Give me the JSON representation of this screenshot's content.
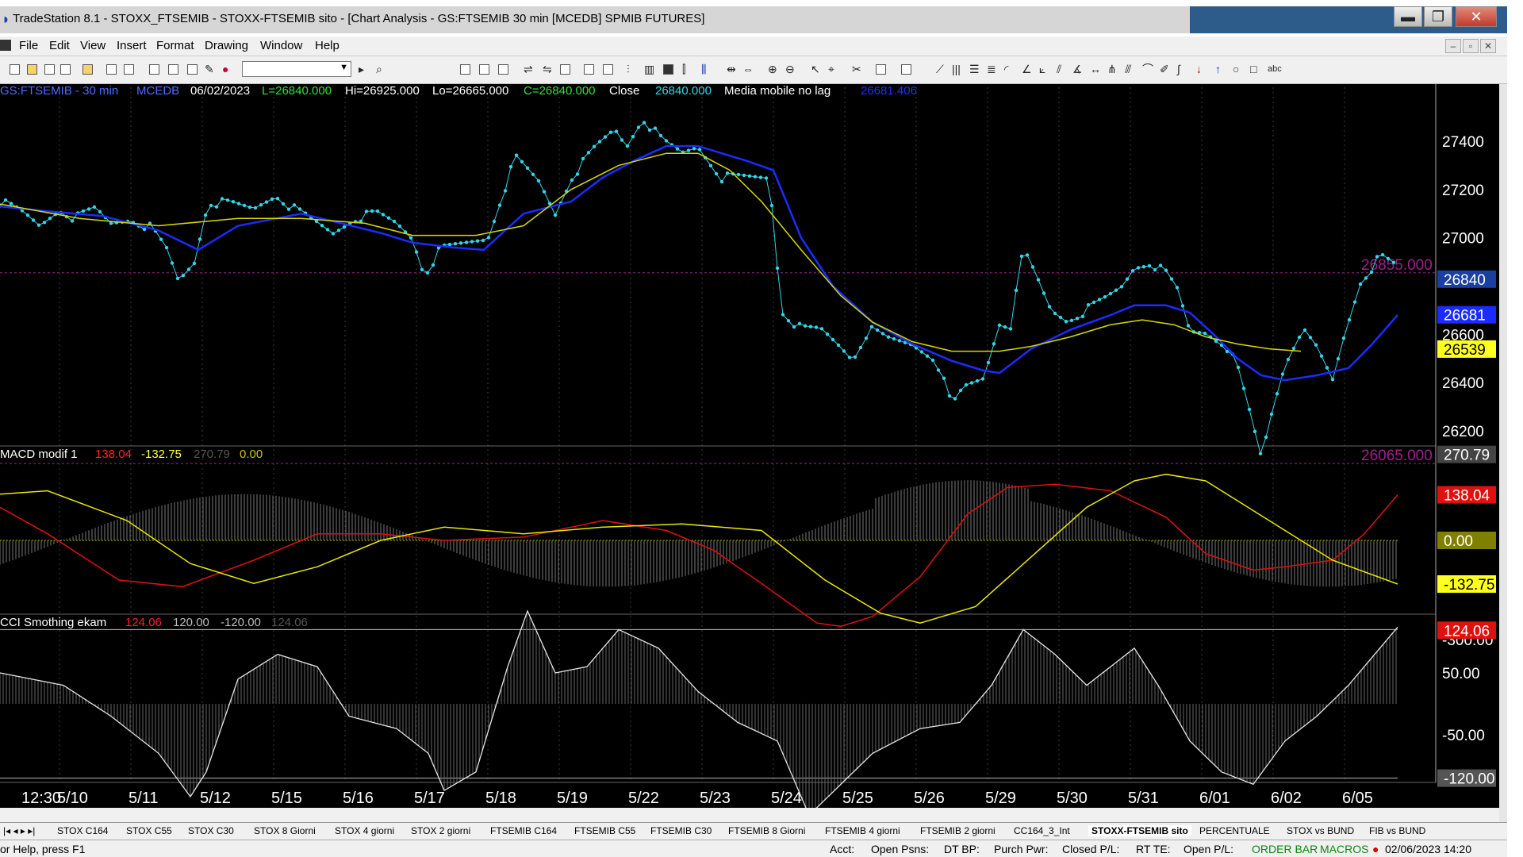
{
  "window": {
    "title": "TradeStation 8.1 - STOXX_FTSEMIB - STOXX-FTSEMIB sito - [Chart Analysis - GS:FTSEMIB  30 min  [MCEDB] SPMIB FUTURES]",
    "controls": {
      "minimize": "▬",
      "maximize": "❐",
      "close": "✕"
    }
  },
  "menu": [
    "File",
    "Edit",
    "View",
    "Insert",
    "Format",
    "Drawing",
    "Window",
    "Help"
  ],
  "price_header": {
    "symbol": "GS:FTSEMIB - 30 min",
    "study": "MCEDB",
    "date": "06/02/2023",
    "last": "L=26840.000",
    "high": "Hi=26925.000",
    "low": "Lo=26665.000",
    "close_eq": "C=26840.000",
    "close_label": "Close",
    "close_value": "26840.000",
    "ma_label": "Media mobile no lag",
    "ma_value": "26681.406"
  },
  "price_axis": {
    "ticks": [
      "27400",
      "27200",
      "27000",
      "26600",
      "26400",
      "26200"
    ],
    "markers": {
      "upper_line": "26855.000",
      "lower_line": "26065.000"
    },
    "labels": {
      "last": "26840",
      "blue": "26681",
      "yellow": "26539"
    }
  },
  "macd_header": {
    "name": "MACD modif 1",
    "v1": "138.04",
    "v2": "-132.75",
    "v3": "270.79",
    "v4": "0.00"
  },
  "macd_axis": {
    "ticks": [
      "-300.00"
    ],
    "labels": {
      "gray": "270.79",
      "red": "138.04",
      "zero": "0.00",
      "yellow": "-132.75"
    }
  },
  "cci_header": {
    "name": "CCI Smothing ekam",
    "v1": "124.06",
    "v2": "120.00",
    "v3": "-120.00",
    "v4": "124.06"
  },
  "cci_axis": {
    "ticks": [
      "50.00",
      "-50.00"
    ],
    "labels": {
      "red": "124.06",
      "gray": "-120.00"
    }
  },
  "time_axis": [
    "12:30",
    "5/10",
    "5/11",
    "5/12",
    "5/15",
    "5/16",
    "5/17",
    "5/18",
    "5/19",
    "5/22",
    "5/23",
    "5/24",
    "5/25",
    "5/26",
    "5/29",
    "5/30",
    "5/31",
    "6/01",
    "6/02",
    "6/05"
  ],
  "workspace_tabs": [
    "STOX C164",
    "STOX C55",
    "STOX  C30",
    "STOX  8 Giorni",
    "STOX 4 giorni",
    "STOX  2 giorni",
    "FTSEMIB C164",
    "FTSEMIB C55",
    "FTSEMIB C30",
    "FTSEMIB  8 Giorni",
    "FTSEMIB  4 giorni",
    "FTSEMIB  2 giorni",
    "CC164_3_Int",
    "STOXX-FTSEMIB sito",
    "PERCENTUALE",
    "STOX vs BUND",
    "FIB vs BUND"
  ],
  "active_tab": "STOXX-FTSEMIB sito",
  "status": {
    "help": "or Help, press F1",
    "acct": "Acct:",
    "open_psns": "Open Psns:",
    "dt_bp": "DT BP:",
    "purch_pwr": "Purch Pwr:",
    "closed_pl": "Closed P/L:",
    "rt_te": "RT TE:",
    "open_pl": "Open P/L:",
    "order_bar": "ORDER BAR",
    "macros": "MACROS",
    "datetime": "02/06/2023 14:20"
  },
  "colors": {
    "background": "#000000",
    "price": "#33d6e8",
    "ma_blue": "#1a2cff",
    "ma_yellow": "#d8d800",
    "macd_red": "#e01010",
    "macd_yellow": "#e8e800",
    "grid": "#3a3a3a",
    "magenta": "#a0208c"
  }
}
